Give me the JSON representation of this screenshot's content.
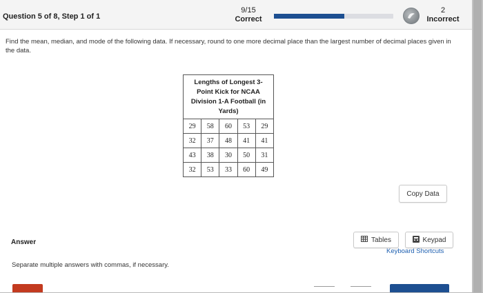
{
  "header": {
    "question_label": "Question 5 of 8, Step 1 of 1",
    "score_value": "9/15",
    "score_label": "Correct",
    "progress_fraction": 0.59,
    "incorrect_count": "2",
    "incorrect_label": "Incorrect",
    "logo_icon": "logo-icon"
  },
  "instructions": "Find the mean, median, and mode of the following data. If necessary, round to one more decimal place than the largest number of decimal places given in the data.",
  "table": {
    "caption": "Lengths of Longest 3-Point Kick for NCAA Division 1-A Football (in Yards)",
    "rows": [
      [
        "29",
        "58",
        "60",
        "53",
        "29"
      ],
      [
        "32",
        "37",
        "48",
        "41",
        "41"
      ],
      [
        "43",
        "38",
        "30",
        "50",
        "31"
      ],
      [
        "32",
        "53",
        "33",
        "60",
        "49"
      ]
    ]
  },
  "buttons": {
    "copy_data": "Copy Data",
    "tables": "Tables",
    "keypad": "Keypad",
    "tables_icon": "table-icon",
    "keypad_icon": "keypad-icon"
  },
  "answer": {
    "label": "Answer",
    "keyboard_shortcuts": "Keyboard Shortcuts",
    "hint": "Separate multiple answers with commas, if necessary."
  },
  "colors": {
    "accent_blue": "#1d4f91",
    "accent_red": "#c33a1f",
    "link_blue": "#1d5fb0"
  }
}
